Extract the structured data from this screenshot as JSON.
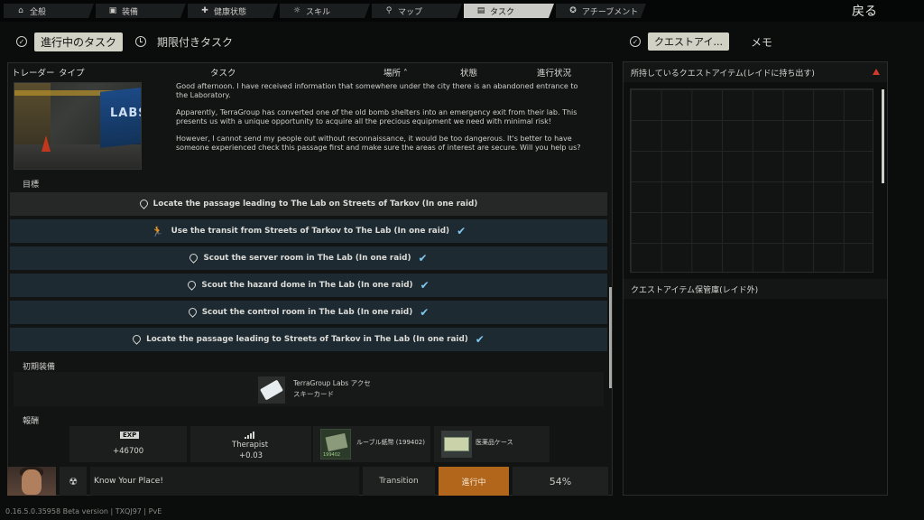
{
  "nav": {
    "tabs": [
      {
        "label": "全般",
        "icon": "home-icon"
      },
      {
        "label": "装備",
        "icon": "gear-box-icon"
      },
      {
        "label": "健康状態",
        "icon": "health-icon"
      },
      {
        "label": "スキル",
        "icon": "skill-icon"
      },
      {
        "label": "マップ",
        "icon": "map-pin-icon"
      },
      {
        "label": "タスク",
        "icon": "task-icon"
      },
      {
        "label": "アチーブメント",
        "icon": "achievement-icon"
      }
    ],
    "active_index": 5,
    "back_label": "戻る"
  },
  "subtabs": {
    "active_label": "進行中のタスク",
    "other_label": "期限付きタスク"
  },
  "columns": {
    "trader": "トレーダー",
    "type": "タイプ",
    "task": "タスク",
    "location": "場所 ˄",
    "status": "状態",
    "progress": "進行状況"
  },
  "quest": {
    "description": [
      "Good afternoon. I have received information that somewhere under the city there is an abandoned entrance to the Laboratory.",
      "Apparently, TerraGroup has converted one of the old bomb shelters into an emergency exit from their lab. This presents us with a unique opportunity to acquire all the precious equipment we need with minimal risk!",
      "However, I cannot send my people out without reconnaissance, it would be too dangerous. It's better to have someone experienced check this passage first and make sure the areas of interest are secure. Will you help us?"
    ],
    "thumb_text": "LABS",
    "objectives_label": "目標",
    "objectives": [
      {
        "text": "Locate the passage leading to The Lab on Streets of Tarkov (In one raid)",
        "icon": "map-pin-icon",
        "done": false
      },
      {
        "text": "Use the transit from Streets of Tarkov to The Lab (In one raid)",
        "icon": "running-man-icon",
        "done": true
      },
      {
        "text": "Scout the server room in The Lab (In one raid)",
        "icon": "map-pin-icon",
        "done": true
      },
      {
        "text": "Scout the hazard dome in The Lab (In one raid)",
        "icon": "map-pin-icon",
        "done": true
      },
      {
        "text": "Scout the control room in The Lab (In one raid)",
        "icon": "map-pin-icon",
        "done": true
      },
      {
        "text": "Locate the passage leading to Streets of Tarkov in The Lab (In one raid)",
        "icon": "map-pin-icon",
        "done": true
      }
    ],
    "check_mark": "✔",
    "equip_label": "初期装備",
    "equip_item_line1": "TerraGroup Labs アクセ",
    "equip_item_line2": "スキーカード",
    "rewards_label": "報酬",
    "rewards": {
      "exp_badge": "EXP",
      "exp_value": "+46700",
      "trader_name": "Therapist",
      "trader_value": "+0.03",
      "money_label": "ルーブル紙幣 (199402)",
      "money_count": "199402",
      "case_label": "医薬品ケース"
    }
  },
  "bottom_row": {
    "name": "Know Your Place!",
    "location": "Transition",
    "status": "進行中",
    "progress": "54%"
  },
  "version": "0.16.5.0.35958 Beta version | TXQJ97 | PvE",
  "right": {
    "active_label": "クエストアイ...",
    "other_label": "メモ",
    "held_items_title": "所持しているクエストアイテム(レイドに持ち出す)",
    "storage_title": "クエストアイテム保管庫(レイド外)"
  }
}
